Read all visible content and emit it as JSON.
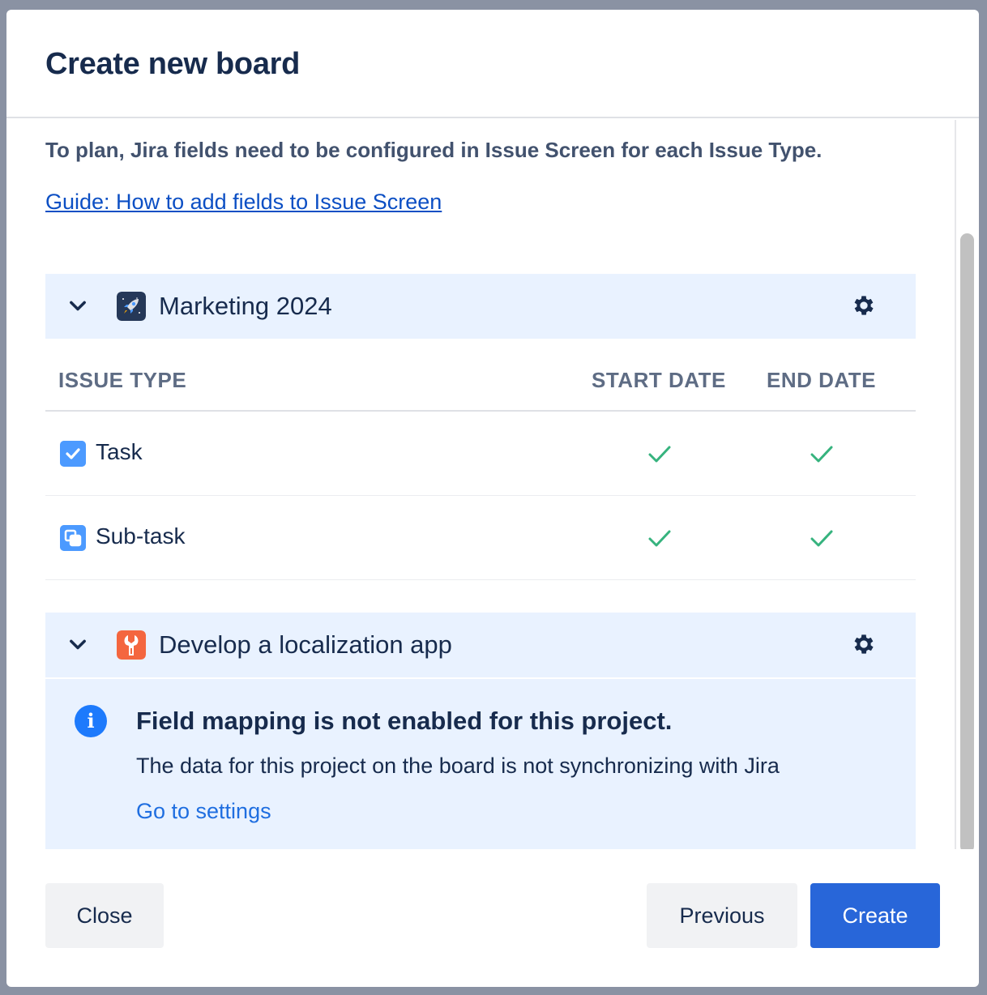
{
  "modal": {
    "title": "Create new board",
    "intro": "To plan, Jira fields need to be configured in Issue Screen for each Issue Type.",
    "guide_link": "Guide: How to add fields to Issue Screen"
  },
  "projects": [
    {
      "name": "Marketing 2024",
      "icon": "rocket-icon",
      "icon_color": "#253858",
      "expanded": true,
      "columns": [
        "ISSUE TYPE",
        "START DATE",
        "END DATE"
      ],
      "rows": [
        {
          "type": "Task",
          "icon": "task-checkbox-icon",
          "start_date": true,
          "end_date": true
        },
        {
          "type": "Sub-task",
          "icon": "subtask-icon",
          "start_date": true,
          "end_date": true
        }
      ]
    },
    {
      "name": "Develop a localization app",
      "icon": "wrench-icon",
      "icon_color": "#f4663f",
      "expanded": true,
      "notice": {
        "title": "Field mapping is not enabled for this project.",
        "description": "The data for this project on the board is not synchronizing with Jira",
        "link": "Go to settings"
      }
    }
  ],
  "footer": {
    "close_label": "Close",
    "previous_label": "Previous",
    "create_label": "Create"
  },
  "colors": {
    "accent": "#2866d9",
    "check": "#36b37e",
    "info": "#1d7afc",
    "panel": "#e9f2ff"
  }
}
